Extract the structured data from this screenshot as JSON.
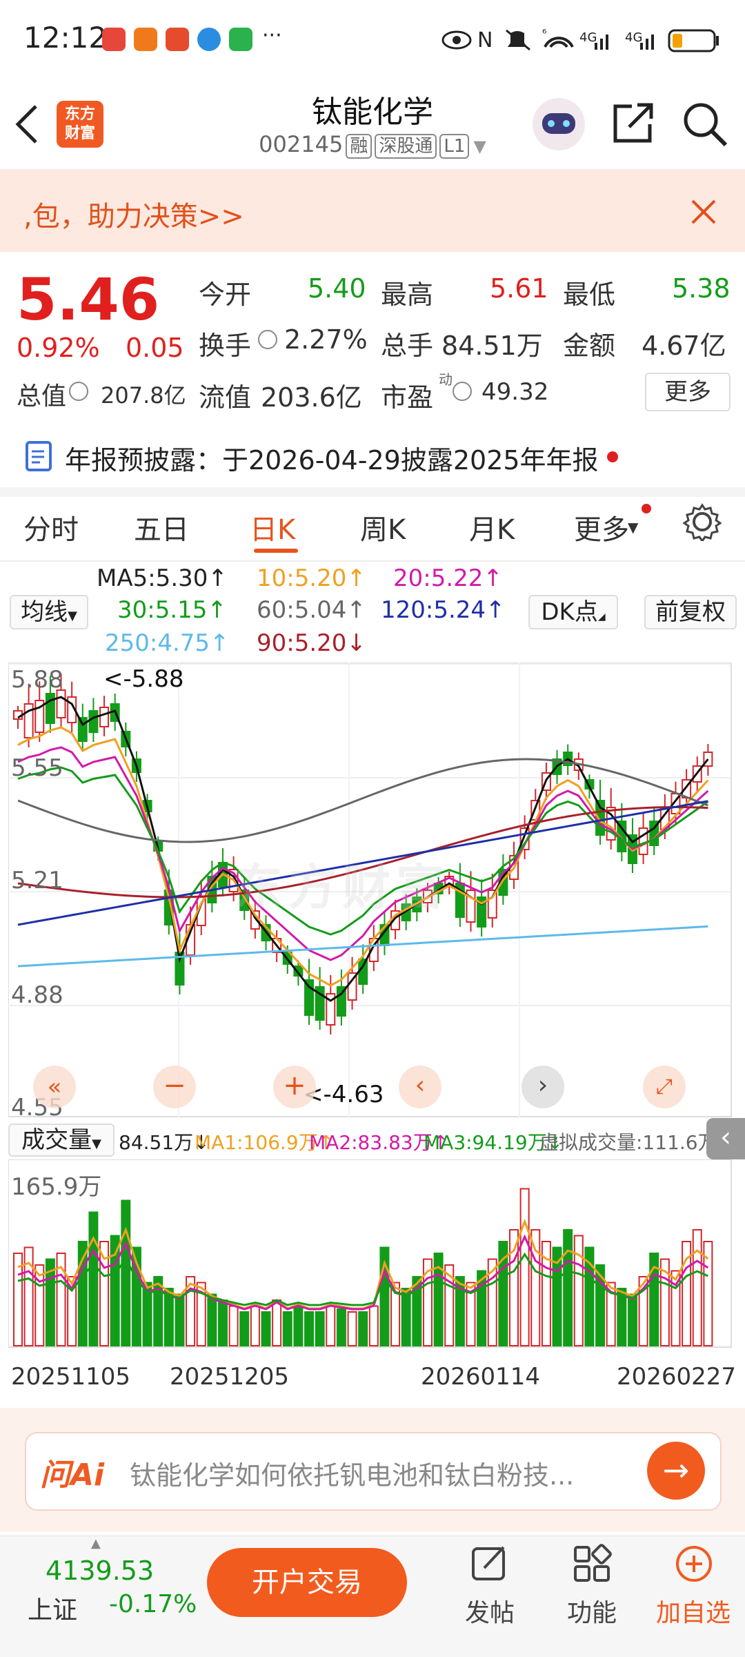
{
  "status_bar": {
    "time": "12:12",
    "more": "···",
    "net1": "⁶",
    "net2": "4G",
    "net3": "4G"
  },
  "header": {
    "stock_name": "钛能化学",
    "stock_code": "002145",
    "tag_rong": "融",
    "tag_sgt": "深股通",
    "tag_level": "L1",
    "logo_line1": "东方",
    "logo_line2": "财富"
  },
  "banner": {
    "text": ",包，助力决策>>"
  },
  "quote": {
    "price": "5.46",
    "change_pct": "0.92%",
    "change_amt": "0.05",
    "open_label": "今开",
    "open": "5.40",
    "high_label": "最高",
    "high": "5.61",
    "low_label": "最低",
    "low": "5.38",
    "turnover_label": "换手",
    "turnover": "2.27%",
    "volume_label": "总手",
    "volume": "84.51万",
    "amount_label": "金额",
    "amount": "4.67亿",
    "mktcap_label": "总值",
    "mktcap": "207.8亿",
    "float_label": "流值",
    "float": "203.6亿",
    "pe_label": "市盈",
    "pe_sup": "动",
    "pe": "49.32",
    "more_label": "更多"
  },
  "notice": {
    "text": "年报预披露：于2026-04-29披露2025年年报"
  },
  "tabs": [
    "分时",
    "五日",
    "日K",
    "周K",
    "月K",
    "更多"
  ],
  "ma_legend": {
    "selector": "均线",
    "ma5": "MA5:5.30↑",
    "ma10": "10:5.20↑",
    "ma20": "20:5.22↑",
    "ma30": "30:5.15↑",
    "ma60": "60:5.04↑",
    "ma120": "120:5.24↑",
    "ma250": "250:4.75↑",
    "ma90": "90:5.20↓",
    "dk_label": "DK点",
    "fq_label": "前复权"
  },
  "kline": {
    "price_labels": [
      "5.88",
      "5.55",
      "5.21",
      "4.88",
      "4.55"
    ],
    "high_marker": "<-5.88",
    "low_marker": "<-4.63",
    "watermark": "东方财富"
  },
  "volume": {
    "selector": "成交量",
    "vol": "84.51万↓",
    "ma1": "MA1:106.9万↑",
    "ma2": "MA2:83.83万↑",
    "ma3": "MA3:94.19万↓",
    "virtual": "虚拟成交量:111.6万",
    "max_label": "165.9万"
  },
  "dates": [
    "20251105",
    "20251205",
    "20260114",
    "20260227"
  ],
  "ai": {
    "logo": "问Ai",
    "prompt": "钛能化学如何依托钒电池和钛白粉技..."
  },
  "bottom": {
    "index_value": "4139.53",
    "index_name": "上证",
    "index_change": "-0.17%",
    "trade_label": "开户交易",
    "post_label": "发帖",
    "func_label": "功能",
    "add_label": "加自选"
  },
  "colors": {
    "red": "#e0201e",
    "green": "#139c1a",
    "accent": "#f25b1e"
  }
}
